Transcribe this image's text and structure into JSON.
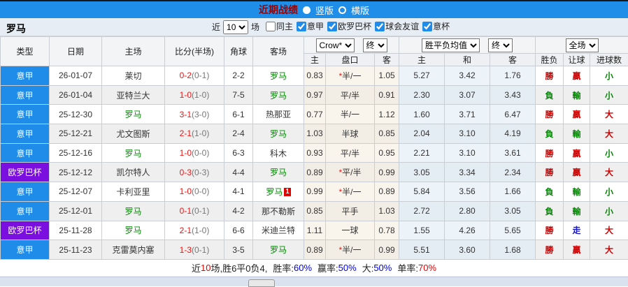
{
  "titlebar": {
    "title": "近期战绩",
    "vertical_label": "竖版",
    "horizontal_label": "横版",
    "vertical_selected": true
  },
  "filterbar": {
    "team": "罗马",
    "near_label": "近",
    "count_value": "10",
    "unit_label": "场",
    "checkboxes": [
      {
        "label": "同主",
        "checked": false
      },
      {
        "label": "意甲",
        "checked": true
      },
      {
        "label": "欧罗巴杯",
        "checked": true
      },
      {
        "label": "球会友谊",
        "checked": true
      },
      {
        "label": "意杯",
        "checked": true
      }
    ]
  },
  "table": {
    "headers": {
      "type": "类型",
      "date": "日期",
      "home": "主场",
      "score": "比分(半场)",
      "corner": "角球",
      "away": "客场",
      "odds_select": "Crow*",
      "odds_time_select": "终",
      "avg_select": "胜平负均值",
      "avg_time_select": "终",
      "scope_select": "全场",
      "sub": {
        "home": "主",
        "handicap": "盘口",
        "away": "客",
        "avg_home": "主",
        "avg_draw": "和",
        "avg_away": "客",
        "wl": "胜负",
        "handicap_res": "让球",
        "goals": "进球数"
      }
    },
    "rows": [
      {
        "league": "意甲",
        "league_color": "blue",
        "date": "26-01-07",
        "home": "莱切",
        "home_is_roma": false,
        "score_ft": "0-2",
        "score_ht": "(0-1)",
        "corner": "2-2",
        "away": "罗马",
        "away_is_roma": true,
        "away_badge": "",
        "odds_home": "0.83",
        "handicap": "*半/一",
        "odds_away": "1.05",
        "avg_home": "5.27",
        "avg_draw": "3.42",
        "avg_away": "1.76",
        "result": "勝",
        "result_color": "r",
        "handicap_result": "贏",
        "handicap_result_color": "r",
        "goals": "小",
        "goals_color": "g"
      },
      {
        "league": "意甲",
        "league_color": "blue",
        "date": "26-01-04",
        "home": "亚特兰大",
        "home_is_roma": false,
        "score_ft": "1-0",
        "score_ht": "(1-0)",
        "corner": "7-5",
        "away": "罗马",
        "away_is_roma": true,
        "away_badge": "",
        "odds_home": "0.97",
        "handicap": "平/半",
        "odds_away": "0.91",
        "avg_home": "2.30",
        "avg_draw": "3.07",
        "avg_away": "3.43",
        "result": "負",
        "result_color": "g",
        "handicap_result": "輸",
        "handicap_result_color": "g",
        "goals": "小",
        "goals_color": "g"
      },
      {
        "league": "意甲",
        "league_color": "blue",
        "date": "25-12-30",
        "home": "罗马",
        "home_is_roma": true,
        "score_ft": "3-1",
        "score_ht": "(3-0)",
        "corner": "6-1",
        "away": "热那亚",
        "away_is_roma": false,
        "away_badge": "",
        "odds_home": "0.77",
        "handicap": "半/一",
        "odds_away": "1.12",
        "avg_home": "1.60",
        "avg_draw": "3.71",
        "avg_away": "6.47",
        "result": "勝",
        "result_color": "r",
        "handicap_result": "贏",
        "handicap_result_color": "r",
        "goals": "大",
        "goals_color": "r"
      },
      {
        "league": "意甲",
        "league_color": "blue",
        "date": "25-12-21",
        "home": "尤文图斯",
        "home_is_roma": false,
        "score_ft": "2-1",
        "score_ht": "(1-0)",
        "corner": "2-4",
        "away": "罗马",
        "away_is_roma": true,
        "away_badge": "",
        "odds_home": "1.03",
        "handicap": "半球",
        "odds_away": "0.85",
        "avg_home": "2.04",
        "avg_draw": "3.10",
        "avg_away": "4.19",
        "result": "負",
        "result_color": "g",
        "handicap_result": "輸",
        "handicap_result_color": "g",
        "goals": "大",
        "goals_color": "r"
      },
      {
        "league": "意甲",
        "league_color": "blue",
        "date": "25-12-16",
        "home": "罗马",
        "home_is_roma": true,
        "score_ft": "1-0",
        "score_ht": "(0-0)",
        "corner": "6-3",
        "away": "科木",
        "away_is_roma": false,
        "away_badge": "",
        "odds_home": "0.93",
        "handicap": "平/半",
        "odds_away": "0.95",
        "avg_home": "2.21",
        "avg_draw": "3.10",
        "avg_away": "3.61",
        "result": "勝",
        "result_color": "r",
        "handicap_result": "贏",
        "handicap_result_color": "r",
        "goals": "小",
        "goals_color": "g"
      },
      {
        "league": "欧罗巴杯",
        "league_color": "purple",
        "date": "25-12-12",
        "home": "凯尔特人",
        "home_is_roma": false,
        "score_ft": "0-3",
        "score_ht": "(0-3)",
        "corner": "4-4",
        "away": "罗马",
        "away_is_roma": true,
        "away_badge": "",
        "odds_home": "0.89",
        "handicap": "*平/半",
        "odds_away": "0.99",
        "avg_home": "3.05",
        "avg_draw": "3.34",
        "avg_away": "2.34",
        "result": "勝",
        "result_color": "r",
        "handicap_result": "贏",
        "handicap_result_color": "r",
        "goals": "大",
        "goals_color": "r"
      },
      {
        "league": "意甲",
        "league_color": "blue",
        "date": "25-12-07",
        "home": "卡利亚里",
        "home_is_roma": false,
        "score_ft": "1-0",
        "score_ht": "(0-0)",
        "corner": "4-1",
        "away": "罗马",
        "away_is_roma": true,
        "away_badge": "1",
        "odds_home": "0.99",
        "handicap": "*半/一",
        "odds_away": "0.89",
        "avg_home": "5.84",
        "avg_draw": "3.56",
        "avg_away": "1.66",
        "result": "負",
        "result_color": "g",
        "handicap_result": "輸",
        "handicap_result_color": "g",
        "goals": "小",
        "goals_color": "g"
      },
      {
        "league": "意甲",
        "league_color": "blue",
        "date": "25-12-01",
        "home": "罗马",
        "home_is_roma": true,
        "score_ft": "0-1",
        "score_ht": "(0-1)",
        "corner": "4-2",
        "away": "那不勒斯",
        "away_is_roma": false,
        "away_badge": "",
        "odds_home": "0.85",
        "handicap": "平手",
        "odds_away": "1.03",
        "avg_home": "2.72",
        "avg_draw": "2.80",
        "avg_away": "3.05",
        "result": "負",
        "result_color": "g",
        "handicap_result": "輸",
        "handicap_result_color": "g",
        "goals": "小",
        "goals_color": "g"
      },
      {
        "league": "欧罗巴杯",
        "league_color": "purple",
        "date": "25-11-28",
        "home": "罗马",
        "home_is_roma": true,
        "score_ft": "2-1",
        "score_ht": "(1-0)",
        "corner": "6-6",
        "away": "米迪兰特",
        "away_is_roma": false,
        "away_badge": "",
        "odds_home": "1.11",
        "handicap": "一球",
        "odds_away": "0.78",
        "avg_home": "1.55",
        "avg_draw": "4.26",
        "avg_away": "5.65",
        "result": "勝",
        "result_color": "r",
        "handicap_result": "走",
        "handicap_result_color": "b",
        "goals": "大",
        "goals_color": "r"
      },
      {
        "league": "意甲",
        "league_color": "blue",
        "date": "25-11-23",
        "home": "克雷莫内塞",
        "home_is_roma": false,
        "score_ft": "1-3",
        "score_ht": "(0-1)",
        "corner": "3-5",
        "away": "罗马",
        "away_is_roma": true,
        "away_badge": "",
        "odds_home": "0.89",
        "handicap": "*半/一",
        "odds_away": "0.99",
        "avg_home": "5.51",
        "avg_draw": "3.60",
        "avg_away": "1.68",
        "result": "勝",
        "result_color": "r",
        "handicap_result": "贏",
        "handicap_result_color": "r",
        "goals": "大",
        "goals_color": "r"
      }
    ]
  },
  "summary": {
    "near_label": "近",
    "match_count": "10",
    "record": "场,胜6平0负4,",
    "win_rate_label": "胜率:",
    "win_rate": "60%",
    "handicap_rate_label": "赢率:",
    "handicap_rate": "50%",
    "big_rate_label": "大:",
    "big_rate": "50%",
    "single_rate_label": "单率:",
    "single_rate": "70%"
  },
  "colors": {
    "titlebar_bg": "#1f8ee8",
    "title_text": "#990000",
    "league_blue": "#1e8ce8",
    "league_purple": "#7b0fe0",
    "roma_green": "#008800",
    "score_red": "#e61717",
    "half_time_gray": "#777777",
    "win_red": "#cc0000",
    "lose_green": "#008800",
    "draw_blue": "#1414cc",
    "rate_blue": "#0000e6",
    "rate_red": "#e60000",
    "handicap_col_bg": "#faf5ec",
    "avg_col_bg": "#ecf4fa"
  }
}
